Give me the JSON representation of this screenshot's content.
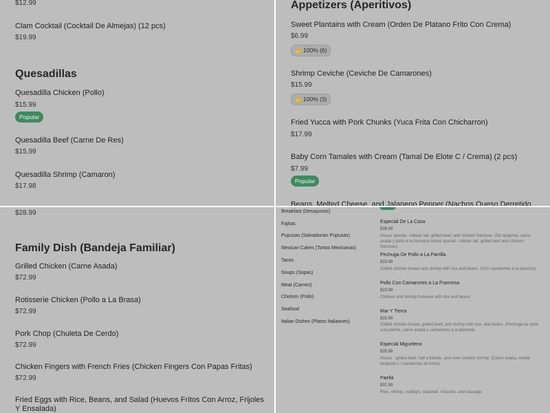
{
  "tl": {
    "top_price": "$12.99",
    "clam_name": "Clam Cocktail (Cocktail De Almejas) (12 pcs)",
    "clam_price": "$19.99",
    "section": "Quesadillas",
    "items": [
      {
        "name": "Quesadilla Chicken (Pollo)",
        "price": "$15.99",
        "badge": "Popular"
      },
      {
        "name": "Quesadilla Beef (Carne De Res)",
        "price": "$15.99"
      },
      {
        "name": "Quesadilla Shrimp (Camaron)",
        "price": "$17.98"
      }
    ]
  },
  "tr": {
    "section": "Appetizers (Aperitivos)",
    "items": [
      {
        "name": "Sweet Plantains with Cream (Orden De Platano Frito Con Crema)",
        "price": "$6.99",
        "rating": "100% (6)"
      },
      {
        "name": "Shrimp Ceviche (Ceviche De Camarones)",
        "price": "$15.99",
        "rating": "100% (3)"
      },
      {
        "name": "Fried Yucca with Pork Chunks (Yuca Frita Con Chicharron)",
        "price": "$17.99"
      },
      {
        "name": "Baby Corn Tamales with Cream (Tamal De Elote C / Crema) (2 pcs)",
        "price": "$7.99",
        "badge": "Popular"
      },
      {
        "name": "Beans, Melted Cheese, and Jalapeno Pepper (Nachos Queso Derretido"
      }
    ]
  },
  "bl": {
    "top_price": "$28.99",
    "section": "Family Dish (Bandeja Familiar)",
    "items": [
      {
        "name": "Grilled Chicken (Carne Asada)",
        "price": "$72.99"
      },
      {
        "name": "Rotisserie Chicken (Pollo a La Brasa)",
        "price": "$72.99"
      },
      {
        "name": "Pork Chop (Chuleta De Cerdo)",
        "price": "$72.99"
      },
      {
        "name": "Chicken Fingers with French Fries (Chicken Fingers Con Papas Fritas)",
        "price": "$72.99"
      },
      {
        "name": "Fried Eggs with Rice, Beans, and Salad (Huevos Fritos Con Arroz, Frijoles Y Ensalada)"
      }
    ]
  },
  "br": {
    "nav": [
      "Breakfast (Desayunos)",
      "Fajitas",
      "Pupusas (Salvadorian Pupusas)",
      "Mexican Cakes (Tortas Mexicanas)",
      "Tacos",
      "Soups (Sopas)",
      "Meat (Carnes)",
      "Chicken (Pollo)",
      "Seafood",
      "Italian Dishes (Platos Italiaones)"
    ],
    "items": [
      {
        "name": "Especial De La Casa",
        "price": "$38.99",
        "desc": "House special - lobster tail, grilled beef, and chicken francese. (De langosta, carne asada y pollo a la francesa house special - lobster tail, grilled beef and chicken francese)"
      },
      {
        "name": "Pechuga De Pollo a La Parrilla",
        "price": "$23.99",
        "desc": "Grilled chicken breast and shrimp with rice and beans. (Con camarones a la plancha)"
      },
      {
        "name": "Pollo Con Camarones a La Francesa",
        "price": "$23.99",
        "desc": "Chicken and shrimp francese with rice and beans"
      },
      {
        "name": "Mar Y Tierra",
        "price": "$28.99",
        "desc": "Grilled chicken breast, grilled beef, and shrimp with rice, and beans. (Pechuga de pollo a la parrilla, carne asada y camarones a la plancha)"
      },
      {
        "name": "Especial Migueleno",
        "price": "$35.99",
        "desc": "House - grilled beef, half a lobster, and oven cooked shrimp. (Carne asada, media langosta c / camarones al horno)"
      },
      {
        "name": "Paella",
        "price": "$32.99",
        "desc": "Rice, shrimp, scallops, calamari, mussels, and sausage"
      }
    ]
  }
}
